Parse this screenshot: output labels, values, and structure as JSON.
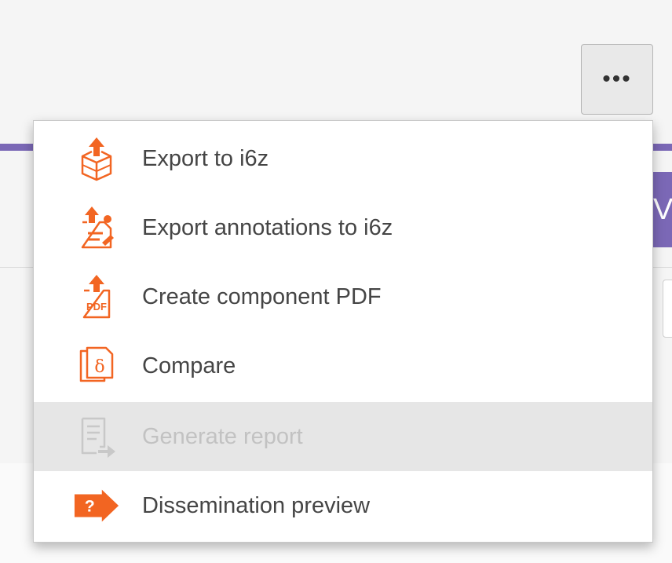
{
  "toolbar": {
    "more_label": "•••",
    "background_button_label": "V"
  },
  "menu": {
    "items": [
      {
        "label": "Export to i6z",
        "icon": "export-cube-icon",
        "disabled": false
      },
      {
        "label": "Export annotations to i6z",
        "icon": "export-annotations-icon",
        "disabled": false
      },
      {
        "label": "Create component PDF",
        "icon": "pdf-export-icon",
        "pdf_text": "PDF",
        "disabled": false
      },
      {
        "label": "Compare",
        "icon": "compare-delta-icon",
        "delta": "δ",
        "disabled": false
      },
      {
        "label": "Generate report",
        "icon": "report-icon",
        "disabled": true
      },
      {
        "label": "Dissemination preview",
        "icon": "dissemination-arrow-icon",
        "question": "?",
        "disabled": false
      }
    ]
  },
  "colors": {
    "accent": "#f26522",
    "purple": "#7b68b6",
    "disabled_icon": "#c8c8c8"
  }
}
